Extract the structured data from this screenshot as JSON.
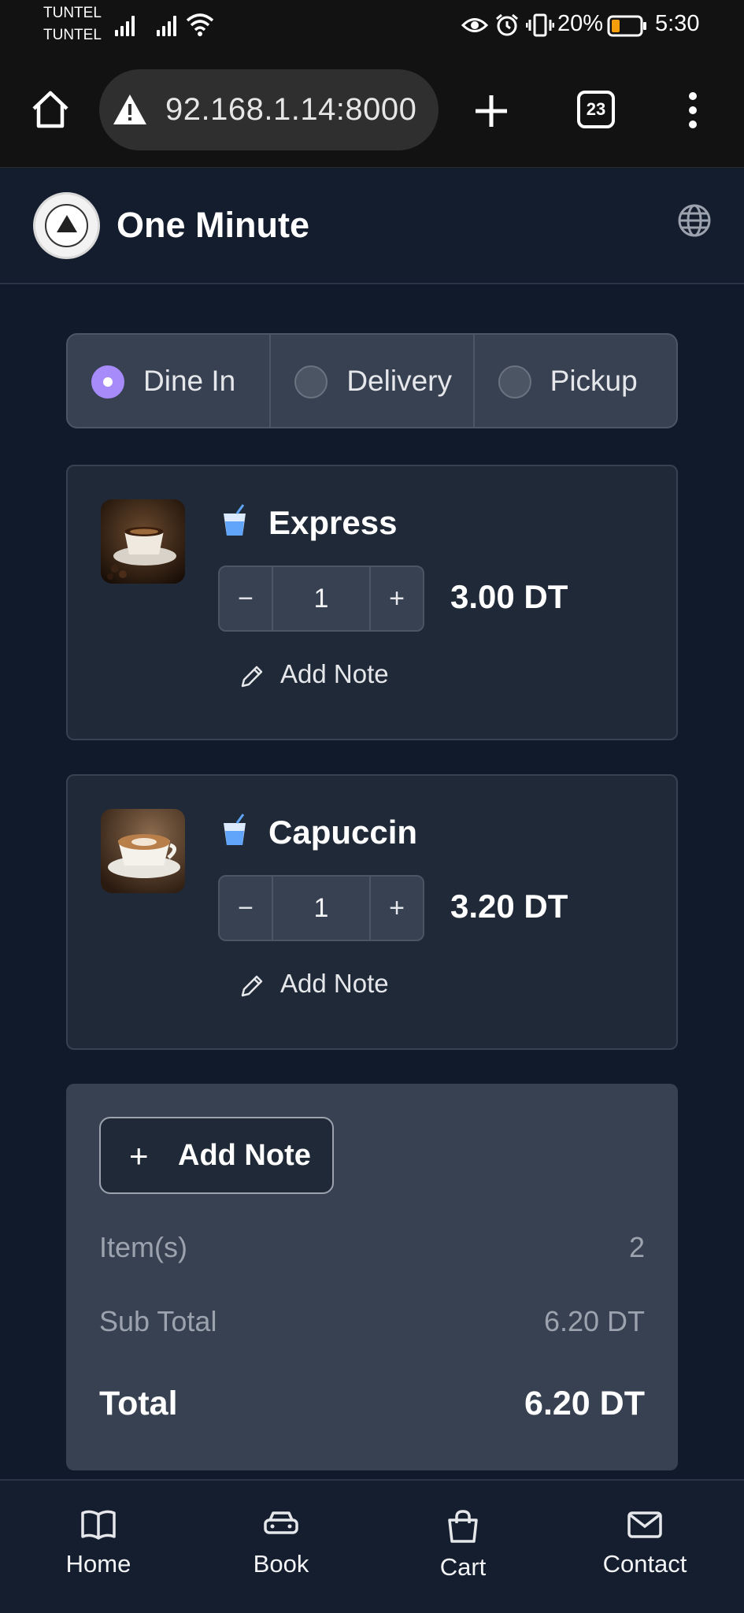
{
  "status_bar": {
    "carrier1": "TUNTEL",
    "carrier2": "TUNTEL",
    "battery": "20%",
    "time": "5:30"
  },
  "browser": {
    "url": "92.168.1.14:8000",
    "tab_count": "23"
  },
  "header": {
    "app_name": "One Minute"
  },
  "order_type": {
    "options": [
      "Dine In",
      "Delivery",
      "Pickup"
    ],
    "selected": "Dine In"
  },
  "items": [
    {
      "name": "Express",
      "quantity": "1",
      "price": "3.00 DT",
      "note_label": "Add Note"
    },
    {
      "name": "Capuccin",
      "quantity": "1",
      "price": "3.20 DT",
      "note_label": "Add Note"
    }
  ],
  "summary": {
    "add_note_label": "Add Note",
    "items_label": "Item(s)",
    "items_value": "2",
    "subtotal_label": "Sub Total",
    "subtotal_value": "6.20 DT",
    "total_label": "Total",
    "total_value": "6.20 DT"
  },
  "bottom_nav": [
    "Home",
    "Book",
    "Cart",
    "Contact"
  ],
  "colors": {
    "accent": "#a78bfa",
    "background": "#111a2b",
    "card": "#1f2937",
    "summary_bg": "#374151"
  }
}
